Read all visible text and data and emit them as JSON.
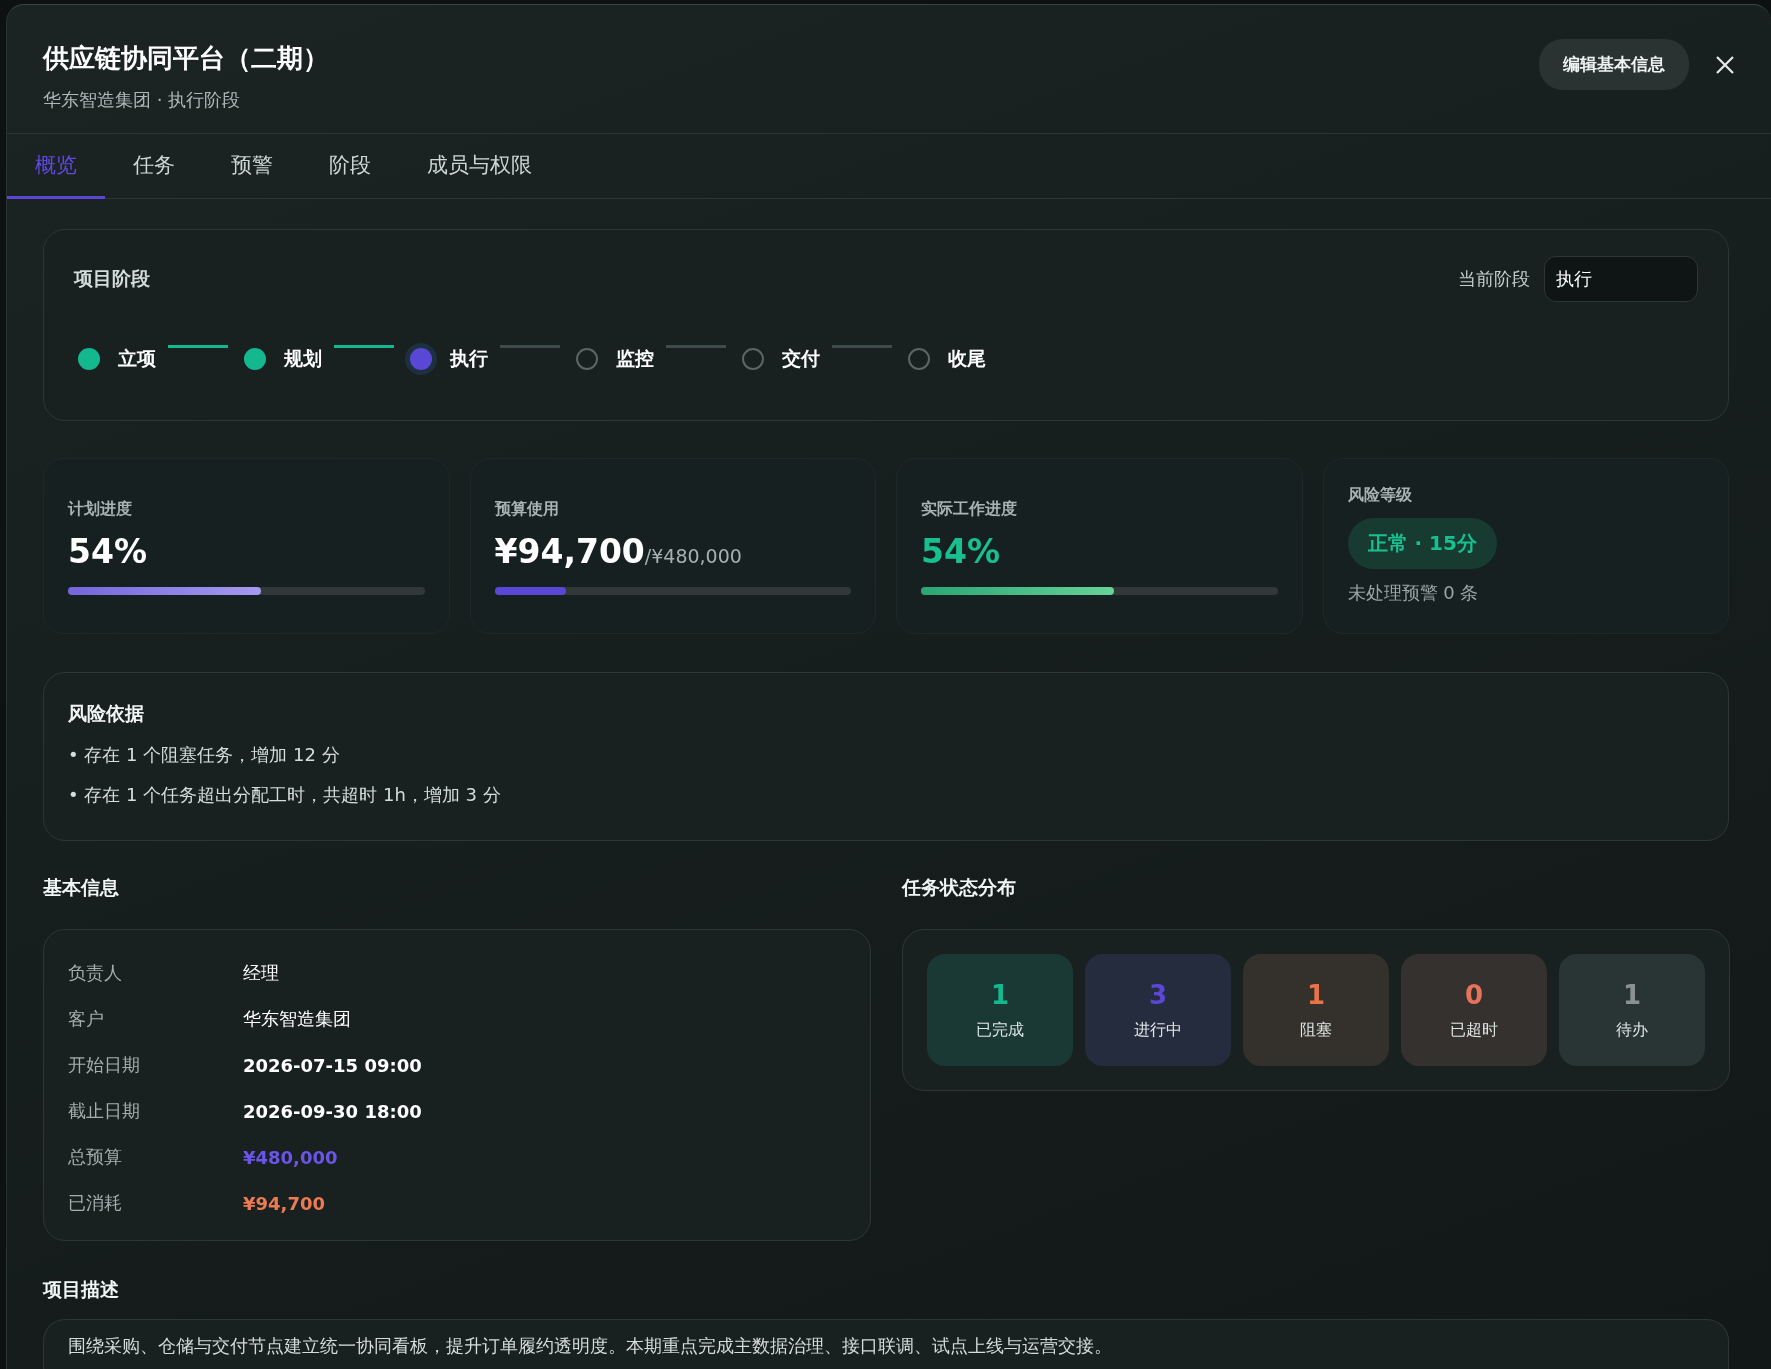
{
  "header": {
    "title": "供应链协同平台（二期）",
    "subtitle": "华东智造集团 · 执行阶段",
    "edit_button": "编辑基本信息"
  },
  "tabs": [
    {
      "label": "概览",
      "selected": true
    },
    {
      "label": "任务",
      "selected": false
    },
    {
      "label": "预警",
      "selected": false
    },
    {
      "label": "阶段",
      "selected": false
    },
    {
      "label": "成员与权限",
      "selected": false
    }
  ],
  "stage": {
    "title": "项目阶段",
    "current_label": "当前阶段",
    "current_value": "执行",
    "steps": [
      {
        "label": "立项",
        "completed": true,
        "current": false
      },
      {
        "label": "规划",
        "completed": true,
        "current": false
      },
      {
        "label": "执行",
        "completed": false,
        "current": true
      },
      {
        "label": "监控",
        "completed": false,
        "current": false
      },
      {
        "label": "交付",
        "completed": false,
        "current": false
      },
      {
        "label": "收尾",
        "completed": false,
        "current": false
      }
    ]
  },
  "metrics": [
    {
      "kind": "plan",
      "label": "计划进度",
      "value": "54%",
      "level": 0.54
    },
    {
      "kind": "budget",
      "label": "预算使用",
      "value": "¥94,700",
      "sub": "/¥480,000",
      "level": 0.2
    },
    {
      "kind": "actual",
      "label": "实际工作进度",
      "value": "54%",
      "level": 0.54
    },
    {
      "kind": "risk",
      "label": "风险等级",
      "badge": "正常 · 15分",
      "note": "未处理预警 0 条"
    }
  ],
  "risk_basis": {
    "title": "风险依据",
    "items": [
      "• 存在 1 个阻塞任务，增加 12 分",
      "• 存在 1 个任务超出分配工时，共超时 1h，增加 3 分"
    ]
  },
  "basic_info": {
    "title": "基本信息",
    "rows": [
      {
        "label": "负责人",
        "value": "经理",
        "kind": "text"
      },
      {
        "label": "客户",
        "value": "华东智造集团",
        "kind": "text"
      },
      {
        "label": "开始日期",
        "value": "2026-07-15 09:00",
        "kind": "text"
      },
      {
        "label": "截止日期",
        "value": "2026-09-30 18:00",
        "kind": "text"
      },
      {
        "label": "总预算",
        "value": "¥480,000",
        "kind": "budget"
      },
      {
        "label": "已消耗",
        "value": "¥94,700",
        "kind": "spent"
      }
    ]
  },
  "task_status": {
    "title": "任务状态分布",
    "items": [
      {
        "count": "1",
        "label": "已完成",
        "color": "#14b88f"
      },
      {
        "count": "3",
        "label": "进行中",
        "color": "#5b47d6"
      },
      {
        "count": "1",
        "label": "阻塞",
        "color": "#e8734a"
      },
      {
        "count": "0",
        "label": "已超时",
        "color": "#e8735a"
      },
      {
        "count": "1",
        "label": "待办",
        "color": "#8a9191"
      }
    ]
  },
  "description": {
    "title": "项目描述",
    "text": "围绕采购、仓储与交付节点建立统一协同看板，提升订单履约透明度。本期重点完成主数据治理、接口联调、试点上线与运营交接。"
  }
}
